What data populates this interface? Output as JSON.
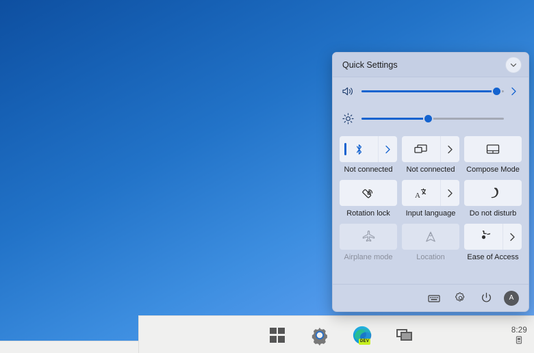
{
  "panel": {
    "title": "Quick Settings",
    "collapse_icon": "chevron-down-icon",
    "accent_color": "#1463cf",
    "background_color": "#ccd5e8"
  },
  "sliders": [
    {
      "name": "volume",
      "icon": "speaker-icon",
      "value": 95,
      "expand_icon": "chevron-right-icon",
      "has_expand": true
    },
    {
      "name": "brightness",
      "icon": "brightness-icon",
      "value": 47,
      "has_expand": false
    }
  ],
  "tiles": [
    {
      "id": "bluetooth",
      "label": "Not connected",
      "icon": "bluetooth-icon",
      "state": "on",
      "has_chevron": true,
      "accent": true
    },
    {
      "id": "cast",
      "label": "Not connected",
      "icon": "cast-icon",
      "state": "off",
      "has_chevron": true,
      "accent": false
    },
    {
      "id": "compose-mode",
      "label": "Compose Mode",
      "icon": "touchpad-icon",
      "state": "off",
      "has_chevron": false,
      "accent": false
    },
    {
      "id": "rotation-lock",
      "label": "Rotation lock",
      "icon": "rotation-lock-icon",
      "state": "off",
      "has_chevron": false,
      "accent": false
    },
    {
      "id": "input-language",
      "label": "Input language",
      "icon": "input-language-icon",
      "state": "off",
      "has_chevron": true,
      "accent": false
    },
    {
      "id": "do-not-disturb",
      "label": "Do not disturb",
      "icon": "moon-icon",
      "state": "off",
      "has_chevron": false,
      "accent": false
    },
    {
      "id": "airplane-mode",
      "label": "Airplane mode",
      "icon": "airplane-icon",
      "state": "disabled",
      "has_chevron": false,
      "accent": false
    },
    {
      "id": "location",
      "label": "Location",
      "icon": "location-icon",
      "state": "disabled",
      "has_chevron": false,
      "accent": false
    },
    {
      "id": "ease-of-access",
      "label": "Ease of Access",
      "icon": "accessibility-icon",
      "state": "off",
      "has_chevron": true,
      "accent": false
    }
  ],
  "footer": [
    {
      "id": "edit-quick-settings",
      "icon": "keyboard-edit-icon"
    },
    {
      "id": "all-settings",
      "icon": "gear-icon"
    },
    {
      "id": "power",
      "icon": "power-icon"
    }
  ],
  "avatar": {
    "initial": "A",
    "color": "#56585c"
  },
  "taskbar": {
    "items": [
      {
        "id": "start",
        "icon": "windows-logo-icon"
      },
      {
        "id": "settings",
        "icon": "gear-icon"
      },
      {
        "id": "edge-dev",
        "icon": "edge-dev-icon",
        "badge": "DEV"
      },
      {
        "id": "task-view",
        "icon": "task-view-icon"
      }
    ],
    "clock": {
      "time": "8:29",
      "tray_icon": "tray-device-icon"
    }
  }
}
